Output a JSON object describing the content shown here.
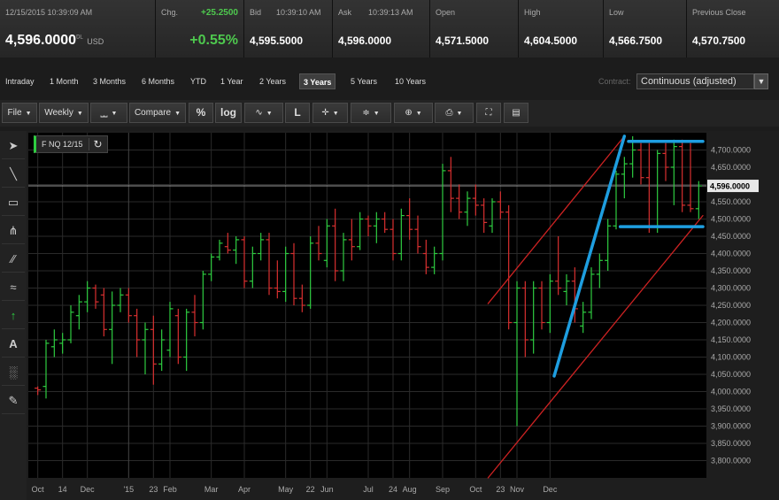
{
  "quote": {
    "timestamp": "12/15/2015 10:39:09 AM",
    "last_price": "4,596.0000",
    "last_suffix": "DL",
    "currency": "USD",
    "change_label": "Chg.",
    "change_value": "+25.2500",
    "change_pct": "+0.55%",
    "bid_label": "Bid",
    "bid_time": "10:39:10 AM",
    "bid_value": "4,595.5000",
    "ask_label": "Ask",
    "ask_time": "10:39:13 AM",
    "ask_value": "4,596.0000",
    "open_label": "Open",
    "open_value": "4,571.5000",
    "high_label": "High",
    "high_value": "4,604.5000",
    "low_label": "Low",
    "low_value": "4,566.7500",
    "prev_label": "Previous Close",
    "prev_value": "4,570.7500"
  },
  "ranges": {
    "tabs": [
      "Intraday",
      "1 Month",
      "3 Months",
      "6 Months",
      "YTD",
      "1 Year",
      "2 Years",
      "3 Years",
      "5 Years",
      "10 Years"
    ],
    "active": "3 Years",
    "contract_label": "Contract:",
    "contract_value": "Continuous (adjusted)"
  },
  "toolbar": {
    "file_label": "File",
    "interval_label": "Weekly",
    "compare_label": "Compare",
    "percent_label": "%",
    "log_label": "log",
    "line_label": "L"
  },
  "drawing_tools": [
    "cursor-arrow-icon",
    "line-icon",
    "rectangle-icon",
    "pitchfork-icon",
    "parallel-lines-icon",
    "fibonacci-icon",
    "arrow-up-icon",
    "text-icon",
    "trash-icon",
    "pencil-icon"
  ],
  "drawing_text_tool": "A",
  "colors": {
    "up_bar": "#2ecc40",
    "down_bar": "#d83030",
    "trend_red": "#cc2222",
    "trend_blue": "#1e9ee0",
    "background": "#000000",
    "grid": "#2a2a2a"
  },
  "chart_data": {
    "type": "ohlc",
    "symbol": "F NQ 12/15",
    "interval": "weekly",
    "last_price_label": "4,596.0000",
    "last_price": 4596,
    "ylim": [
      3750,
      4750
    ],
    "y_ticks": [
      "3,800.0000",
      "3,850.0000",
      "3,900.0000",
      "3,950.0000",
      "4,000.0000",
      "4,050.0000",
      "4,100.0000",
      "4,150.0000",
      "4,200.0000",
      "4,250.0000",
      "4,300.0000",
      "4,350.0000",
      "4,400.0000",
      "4,450.0000",
      "4,500.0000",
      "4,550.0000",
      "4,600.0000",
      "4,650.0000",
      "4,700.0000"
    ],
    "x_labels": [
      {
        "label": "Oct",
        "bar": 0
      },
      {
        "label": "14",
        "bar": 3
      },
      {
        "label": "Dec",
        "bar": 6
      },
      {
        "label": "'15",
        "bar": 11
      },
      {
        "label": "23",
        "bar": 14
      },
      {
        "label": "Feb",
        "bar": 16
      },
      {
        "label": "Mar",
        "bar": 21
      },
      {
        "label": "Apr",
        "bar": 25
      },
      {
        "label": "May",
        "bar": 30
      },
      {
        "label": "22",
        "bar": 33
      },
      {
        "label": "Jun",
        "bar": 35
      },
      {
        "label": "Jul",
        "bar": 40
      },
      {
        "label": "24",
        "bar": 43
      },
      {
        "label": "Aug",
        "bar": 45
      },
      {
        "label": "Sep",
        "bar": 49
      },
      {
        "label": "Oct",
        "bar": 53
      },
      {
        "label": "23",
        "bar": 56
      },
      {
        "label": "Nov",
        "bar": 58
      },
      {
        "label": "Dec",
        "bar": 62
      }
    ],
    "bars": [
      {
        "o": 4010,
        "h": 4015,
        "l": 3990,
        "c": 4005
      },
      {
        "o": 4015,
        "h": 4150,
        "l": 3980,
        "c": 4140
      },
      {
        "o": 4130,
        "h": 4180,
        "l": 4100,
        "c": 4150
      },
      {
        "o": 4140,
        "h": 4170,
        "l": 4110,
        "c": 4150
      },
      {
        "o": 4150,
        "h": 4250,
        "l": 4140,
        "c": 4230
      },
      {
        "o": 4220,
        "h": 4280,
        "l": 4180,
        "c": 4260
      },
      {
        "o": 4260,
        "h": 4320,
        "l": 4230,
        "c": 4300
      },
      {
        "o": 4300,
        "h": 4310,
        "l": 4240,
        "c": 4260
      },
      {
        "o": 4280,
        "h": 4300,
        "l": 4160,
        "c": 4180
      },
      {
        "o": 4180,
        "h": 4290,
        "l": 4080,
        "c": 4250
      },
      {
        "o": 4250,
        "h": 4300,
        "l": 4230,
        "c": 4280
      },
      {
        "o": 4280,
        "h": 4300,
        "l": 4200,
        "c": 4220
      },
      {
        "o": 4220,
        "h": 4240,
        "l": 4100,
        "c": 4150
      },
      {
        "o": 4150,
        "h": 4200,
        "l": 4050,
        "c": 4180
      },
      {
        "o": 4180,
        "h": 4220,
        "l": 4020,
        "c": 4080
      },
      {
        "o": 4080,
        "h": 4180,
        "l": 4060,
        "c": 4150
      },
      {
        "o": 4120,
        "h": 4260,
        "l": 4100,
        "c": 4240
      },
      {
        "o": 4220,
        "h": 4240,
        "l": 4080,
        "c": 4100
      },
      {
        "o": 4100,
        "h": 4240,
        "l": 4060,
        "c": 4230
      },
      {
        "o": 4230,
        "h": 4280,
        "l": 4160,
        "c": 4200
      },
      {
        "o": 4200,
        "h": 4350,
        "l": 4180,
        "c": 4340
      },
      {
        "o": 4340,
        "h": 4400,
        "l": 4320,
        "c": 4390
      },
      {
        "o": 4390,
        "h": 4440,
        "l": 4380,
        "c": 4430
      },
      {
        "o": 4420,
        "h": 4460,
        "l": 4400,
        "c": 4410
      },
      {
        "o": 4410,
        "h": 4450,
        "l": 4370,
        "c": 4440
      },
      {
        "o": 4440,
        "h": 4450,
        "l": 4300,
        "c": 4320
      },
      {
        "o": 4320,
        "h": 4420,
        "l": 4300,
        "c": 4400
      },
      {
        "o": 4400,
        "h": 4460,
        "l": 4380,
        "c": 4440
      },
      {
        "o": 4440,
        "h": 4460,
        "l": 4280,
        "c": 4300
      },
      {
        "o": 4300,
        "h": 4380,
        "l": 4270,
        "c": 4290
      },
      {
        "o": 4290,
        "h": 4420,
        "l": 4260,
        "c": 4400
      },
      {
        "o": 4400,
        "h": 4430,
        "l": 4250,
        "c": 4270
      },
      {
        "o": 4270,
        "h": 4310,
        "l": 4230,
        "c": 4250
      },
      {
        "o": 4250,
        "h": 4450,
        "l": 4240,
        "c": 4430
      },
      {
        "o": 4430,
        "h": 4480,
        "l": 4380,
        "c": 4400
      },
      {
        "o": 4380,
        "h": 4500,
        "l": 4360,
        "c": 4480
      },
      {
        "o": 4480,
        "h": 4530,
        "l": 4320,
        "c": 4350
      },
      {
        "o": 4350,
        "h": 4460,
        "l": 4320,
        "c": 4440
      },
      {
        "o": 4440,
        "h": 4500,
        "l": 4380,
        "c": 4420
      },
      {
        "o": 4420,
        "h": 4520,
        "l": 4410,
        "c": 4500
      },
      {
        "o": 4500,
        "h": 4510,
        "l": 4450,
        "c": 4480
      },
      {
        "o": 4480,
        "h": 4520,
        "l": 4430,
        "c": 4500
      },
      {
        "o": 4500,
        "h": 4520,
        "l": 4460,
        "c": 4470
      },
      {
        "o": 4470,
        "h": 4500,
        "l": 4380,
        "c": 4400
      },
      {
        "o": 4400,
        "h": 4530,
        "l": 4380,
        "c": 4510
      },
      {
        "o": 4510,
        "h": 4560,
        "l": 4440,
        "c": 4470
      },
      {
        "o": 4470,
        "h": 4510,
        "l": 4400,
        "c": 4420
      },
      {
        "o": 4400,
        "h": 4440,
        "l": 4340,
        "c": 4360
      },
      {
        "o": 4360,
        "h": 4420,
        "l": 4340,
        "c": 4400
      },
      {
        "o": 4400,
        "h": 4660,
        "l": 4380,
        "c": 4640
      },
      {
        "o": 4640,
        "h": 4680,
        "l": 4520,
        "c": 4560
      },
      {
        "o": 4560,
        "h": 4600,
        "l": 4500,
        "c": 4520
      },
      {
        "o": 4520,
        "h": 4580,
        "l": 4480,
        "c": 4560
      },
      {
        "o": 4560,
        "h": 4600,
        "l": 4510,
        "c": 4540
      },
      {
        "o": 4540,
        "h": 4560,
        "l": 4460,
        "c": 4490
      },
      {
        "o": 4480,
        "h": 4560,
        "l": 4460,
        "c": 4550
      },
      {
        "o": 4550,
        "h": 4580,
        "l": 4500,
        "c": 4520
      },
      {
        "o": 4520,
        "h": 4540,
        "l": 4180,
        "c": 4200
      },
      {
        "o": 4200,
        "h": 4320,
        "l": 3900,
        "c": 4300
      },
      {
        "o": 4300,
        "h": 4320,
        "l": 4100,
        "c": 4150
      },
      {
        "o": 4150,
        "h": 4320,
        "l": 4110,
        "c": 4300
      },
      {
        "o": 4300,
        "h": 4320,
        "l": 4180,
        "c": 4200
      },
      {
        "o": 4200,
        "h": 4340,
        "l": 4170,
        "c": 4320
      },
      {
        "o": 4320,
        "h": 4450,
        "l": 4280,
        "c": 4300
      },
      {
        "o": 4290,
        "h": 4340,
        "l": 4250,
        "c": 4320
      },
      {
        "o": 4320,
        "h": 4360,
        "l": 4200,
        "c": 4240
      },
      {
        "o": 4190,
        "h": 4260,
        "l": 4170,
        "c": 4230
      },
      {
        "o": 4230,
        "h": 4360,
        "l": 4210,
        "c": 4340
      },
      {
        "o": 4340,
        "h": 4400,
        "l": 4300,
        "c": 4380
      },
      {
        "o": 4380,
        "h": 4500,
        "l": 4350,
        "c": 4480
      },
      {
        "o": 4480,
        "h": 4640,
        "l": 4470,
        "c": 4630
      },
      {
        "o": 4630,
        "h": 4680,
        "l": 4560,
        "c": 4660
      },
      {
        "o": 4660,
        "h": 4740,
        "l": 4620,
        "c": 4700
      },
      {
        "o": 4700,
        "h": 4720,
        "l": 4600,
        "c": 4620
      },
      {
        "o": 4620,
        "h": 4720,
        "l": 4460,
        "c": 4480
      },
      {
        "o": 4480,
        "h": 4700,
        "l": 4460,
        "c": 4690
      },
      {
        "o": 4690,
        "h": 4720,
        "l": 4610,
        "c": 4650
      },
      {
        "o": 4650,
        "h": 4730,
        "l": 4540,
        "c": 4710
      },
      {
        "o": 4710,
        "h": 4730,
        "l": 4520,
        "c": 4540
      },
      {
        "o": 4540,
        "h": 4720,
        "l": 4520,
        "c": 4530
      },
      {
        "o": 4530,
        "h": 4610,
        "l": 4500,
        "c": 4596
      }
    ],
    "annotations": [
      {
        "type": "trendline",
        "color": "trend_red",
        "from": {
          "bar": 54.5,
          "y": 4255
        },
        "to": {
          "bar": 71,
          "y": 4740
        }
      },
      {
        "type": "trendline",
        "color": "trend_red",
        "from": {
          "bar": 54.5,
          "y": 3750
        },
        "to": {
          "bar": 80.5,
          "y": 4510
        }
      },
      {
        "type": "trendline",
        "color": "trend_blue",
        "from": {
          "bar": 62.5,
          "y": 4045
        },
        "to": {
          "bar": 71,
          "y": 4740
        }
      },
      {
        "type": "hline",
        "color": "trend_blue",
        "from": {
          "bar": 71.5,
          "y": 4725
        },
        "to": {
          "bar": 80.5,
          "y": 4725
        }
      },
      {
        "type": "hline",
        "color": "trend_blue",
        "from": {
          "bar": 70.5,
          "y": 4478
        },
        "to": {
          "bar": 80.5,
          "y": 4478
        }
      }
    ]
  }
}
